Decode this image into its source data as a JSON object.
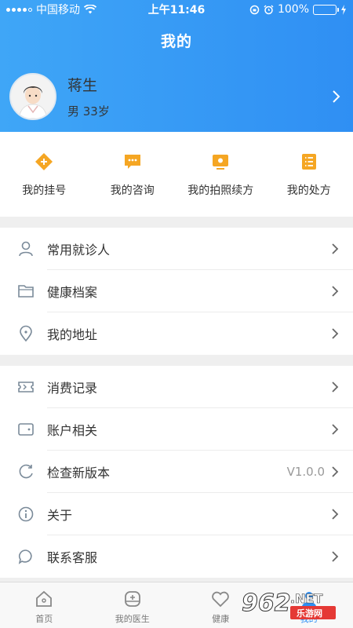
{
  "status_bar": {
    "carrier": "中国移动",
    "time": "上午11:46",
    "battery": "100%",
    "battery_level": 1.0
  },
  "header": {
    "title": "我的"
  },
  "profile": {
    "name": "蒋生",
    "meta": "男 33岁"
  },
  "quick_actions": [
    {
      "label": "我的挂号",
      "icon": "diamond-plus-icon"
    },
    {
      "label": "我的咨询",
      "icon": "chat-bubble-icon"
    },
    {
      "label": "我的拍照续方",
      "icon": "monitor-icon"
    },
    {
      "label": "我的处方",
      "icon": "list-document-icon"
    }
  ],
  "menu_group_1": [
    {
      "label": "常用就诊人",
      "icon": "person-icon"
    },
    {
      "label": "健康档案",
      "icon": "folder-icon"
    },
    {
      "label": "我的地址",
      "icon": "location-pin-icon"
    }
  ],
  "menu_group_2": [
    {
      "label": "消费记录",
      "icon": "ticket-icon"
    },
    {
      "label": "账户相关",
      "icon": "wallet-icon"
    },
    {
      "label": "检查新版本",
      "icon": "refresh-icon",
      "value": "V1.0.0"
    },
    {
      "label": "关于",
      "icon": "info-icon"
    },
    {
      "label": "联系客服",
      "icon": "chat-icon"
    }
  ],
  "tab_bar": [
    {
      "label": "首页",
      "icon": "home-icon"
    },
    {
      "label": "我的医生",
      "icon": "doctor-icon"
    },
    {
      "label": "健康",
      "icon": "heart-icon"
    },
    {
      "label": "我的",
      "icon": "user-icon",
      "active": true
    }
  ],
  "watermark": {
    "big": "962",
    "suffix": ".NET",
    "small": "乐游网"
  },
  "colors": {
    "primary": "#2f8ff3",
    "orange": "#f5a623",
    "icon_gray": "#7a8a99"
  }
}
